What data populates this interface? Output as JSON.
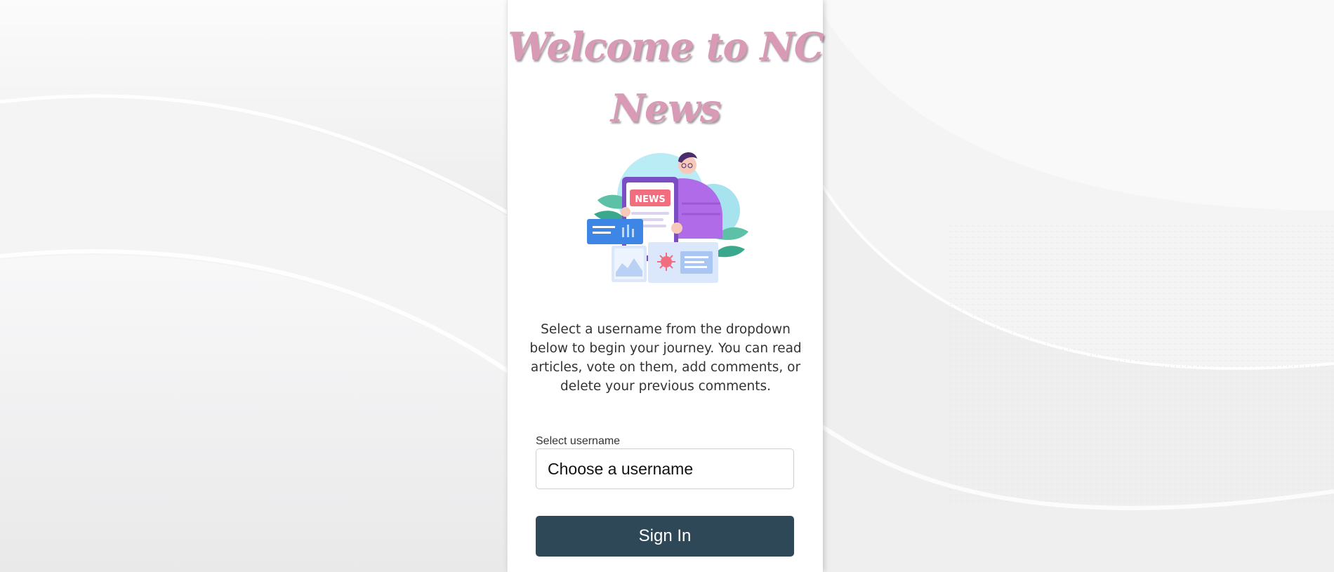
{
  "header": {
    "title": "Welcome to NC News"
  },
  "illustration": {
    "icon": "news-reader-illustration",
    "badge_text": "NEWS"
  },
  "intro": {
    "text": "Select a username from the dropdown below to begin your journey. You can read articles, vote on them, add comments, or delete your previous comments."
  },
  "login": {
    "label": "Select username",
    "selected": "Choose a username",
    "button": "Sign In"
  },
  "colors": {
    "title": "#d99ab6",
    "button": "#2f4858",
    "background": "#f3f3f4",
    "panel": "#ffffff"
  }
}
